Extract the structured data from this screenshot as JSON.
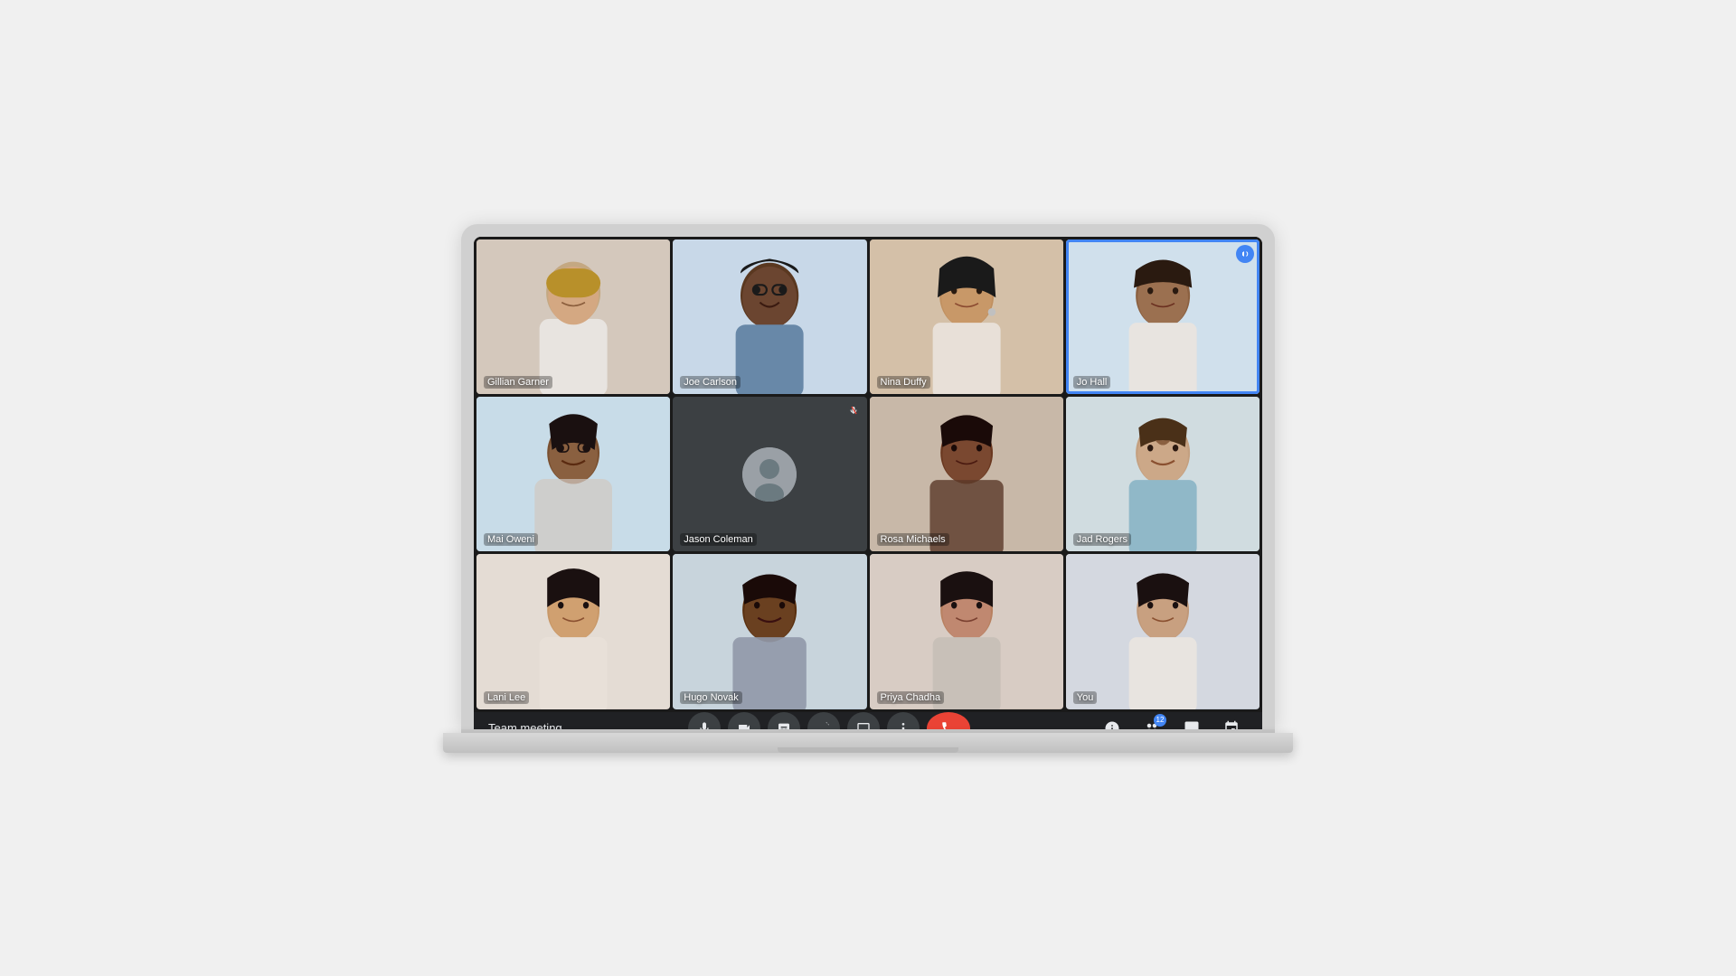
{
  "meeting": {
    "title": "Team meeting"
  },
  "participants": [
    {
      "id": "gillian",
      "name": "Gillian Garner",
      "tile_class": "tile-gillian",
      "has_video": true,
      "is_muted": false,
      "is_active": false,
      "emoji": "👩"
    },
    {
      "id": "joe",
      "name": "Joe Carlson",
      "tile_class": "tile-joe",
      "has_video": true,
      "is_muted": false,
      "is_active": false,
      "emoji": "🧔"
    },
    {
      "id": "nina",
      "name": "Nina Duffy",
      "tile_class": "tile-nina",
      "has_video": true,
      "is_muted": false,
      "is_active": false,
      "emoji": "👩"
    },
    {
      "id": "jo",
      "name": "Jo Hall",
      "tile_class": "tile-jo",
      "has_video": true,
      "is_muted": false,
      "is_active": true,
      "emoji": "👩"
    },
    {
      "id": "mai",
      "name": "Mai Oweni",
      "tile_class": "tile-mai",
      "has_video": true,
      "is_muted": false,
      "is_active": false,
      "emoji": "👩"
    },
    {
      "id": "jason",
      "name": "Jason Coleman",
      "tile_class": "tile-jason",
      "has_video": false,
      "is_muted": true,
      "is_active": false,
      "emoji": "🧑"
    },
    {
      "id": "rosa",
      "name": "Rosa Michaels",
      "tile_class": "tile-rosa",
      "has_video": true,
      "is_muted": false,
      "is_active": false,
      "emoji": "👩"
    },
    {
      "id": "jad",
      "name": "Jad Rogers",
      "tile_class": "tile-jad",
      "has_video": true,
      "is_muted": false,
      "is_active": false,
      "emoji": "👨"
    },
    {
      "id": "lani",
      "name": "Lani Lee",
      "tile_class": "tile-lani",
      "has_video": true,
      "is_muted": false,
      "is_active": false,
      "emoji": "👩"
    },
    {
      "id": "hugo",
      "name": "Hugo Novak",
      "tile_class": "tile-hugo",
      "has_video": true,
      "is_muted": false,
      "is_active": false,
      "emoji": "👨"
    },
    {
      "id": "priya",
      "name": "Priya Chadha",
      "tile_class": "tile-priya",
      "has_video": true,
      "is_muted": false,
      "is_active": false,
      "emoji": "👩"
    },
    {
      "id": "you",
      "name": "You",
      "tile_class": "tile-you",
      "has_video": true,
      "is_muted": false,
      "is_active": false,
      "emoji": "👩"
    }
  ],
  "controls": {
    "mic_label": "🎤",
    "camera_label": "📷",
    "captions_label": "CC",
    "hand_label": "✋",
    "present_label": "▭",
    "more_label": "⋮",
    "end_call_label": "📞",
    "info_label": "ℹ",
    "people_label": "👥",
    "chat_label": "💬",
    "activities_label": "⚡",
    "people_count": "12"
  },
  "colors": {
    "active_speaker_border": "#4285f4",
    "end_call_bg": "#ea4335",
    "control_bg": "#3c4043",
    "bar_bg": "#202124",
    "tile_bg": "#3c4043"
  }
}
